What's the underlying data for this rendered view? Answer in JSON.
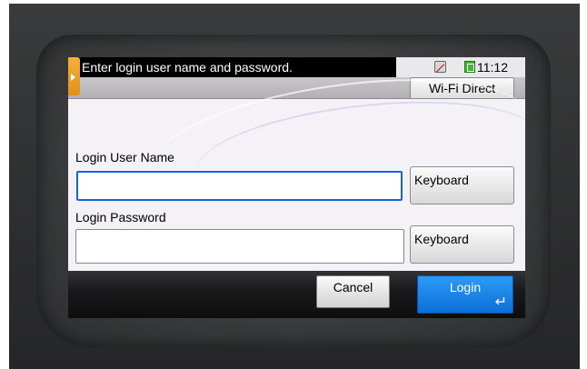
{
  "header": {
    "message": "Enter login user name and password.",
    "time": "11:12",
    "network_icon": "network-status-icon",
    "battery_icon": "status-green-icon"
  },
  "wifi_direct": {
    "label": "Wi-Fi Direct"
  },
  "form": {
    "username_label": "Login User Name",
    "username_value": "",
    "password_label": "Login Password",
    "password_value": "",
    "keyboard_label": "Keyboard"
  },
  "footer": {
    "cancel_label": "Cancel",
    "login_label": "Login",
    "enter_icon": "↵"
  },
  "colors": {
    "accent": "#1866d6",
    "login_button": "#1a86e8",
    "tab": "#f0a22a"
  }
}
